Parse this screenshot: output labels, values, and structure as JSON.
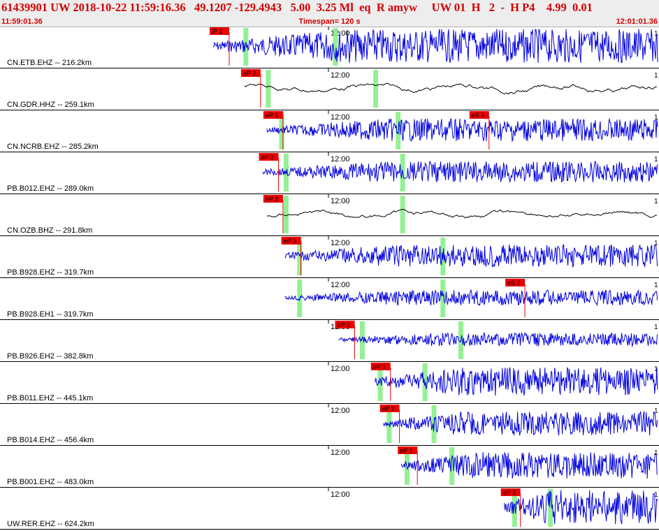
{
  "header": {
    "event_line": "61439901 UW 2018-10-22 11:59:16.36   49.1207 -129.4943   5.00  3.25 Ml  eq  R amyw     UW 01  H   2  -  H P4    4.99  0.01",
    "start_time": "11:59:01.36",
    "timespan": "Timespan= 120 s",
    "end_time": "12:01:01.36"
  },
  "colors": {
    "header_text": "#d40000",
    "trace_primary": "#0000dd",
    "trace_broadband": "#000000",
    "pick_flag": "#ee0000",
    "window_marker": "#88ee88"
  },
  "minute_label": "12:00",
  "end_glyph": "1",
  "traces": [
    {
      "label": "CN.ETB.EHZ -- 216.2km",
      "picks": [
        {
          "text": "iP 1",
          "t": 0.0
        }
      ],
      "windows": [
        0.08,
        0.28
      ],
      "start": 0.0,
      "style": "blue",
      "amp": 0.9
    },
    {
      "label": "CN.GDR.HHZ -- 259.1km",
      "picks": [
        {
          "text": "eP 2",
          "t": 0.07
        }
      ],
      "windows": [
        0.13,
        0.37
      ],
      "start": 0.07,
      "style": "broadband",
      "amp": 0.5
    },
    {
      "label": "CN.NCRB.EHZ -- 285.2km",
      "picks": [
        {
          "text": "eP 1",
          "t": 0.12
        },
        {
          "text": "eS 2",
          "t": 0.58
        }
      ],
      "windows": [
        0.16,
        0.42
      ],
      "start": 0.12,
      "style": "blue",
      "amp": 0.6
    },
    {
      "label": "PB.B012.EHZ -- 289.0km",
      "picks": [
        {
          "text": "eP 2",
          "t": 0.11
        }
      ],
      "windows": [
        0.17,
        0.43
      ],
      "start": 0.11,
      "style": "blue",
      "amp": 0.55
    },
    {
      "label": "CN.OZB.BHZ -- 291.8km",
      "picks": [
        {
          "text": "eP 2",
          "t": 0.12
        }
      ],
      "windows": [
        0.17,
        0.43
      ],
      "start": 0.12,
      "style": "broadband",
      "amp": 0.45
    },
    {
      "label": "PB.B928.EHZ -- 319.7km",
      "picks": [
        {
          "text": "eP 3",
          "t": 0.16
        }
      ],
      "windows": [
        0.2,
        0.52
      ],
      "start": 0.16,
      "style": "blue",
      "amp": 0.6
    },
    {
      "label": "PB.B928.EH1 -- 319.7km",
      "picks": [
        {
          "text": "eS 2",
          "t": 0.66
        }
      ],
      "windows": [
        0.2,
        0.52
      ],
      "start": 0.16,
      "style": "blue",
      "amp": 0.4
    },
    {
      "label": "PB.B926.EH2 -- 382.8km",
      "picks": [
        {
          "text": "eP 2",
          "t": 0.28
        }
      ],
      "windows": [
        0.34,
        0.56
      ],
      "start": 0.28,
      "style": "blue",
      "amp": 0.35
    },
    {
      "label": "PB.B011.EHZ -- 445.1km",
      "picks": [
        {
          "text": "eP 1",
          "t": 0.36
        }
      ],
      "windows": [
        0.38,
        0.48
      ],
      "start": 0.36,
      "style": "blue",
      "amp": 0.75
    },
    {
      "label": "PB.B014.EHZ -- 456.4km",
      "picks": [
        {
          "text": "eP 2",
          "t": 0.38
        }
      ],
      "windows": [
        0.4,
        0.5
      ],
      "start": 0.38,
      "style": "blue",
      "amp": 0.65
    },
    {
      "label": "PB.B001.EHZ -- 483.0km",
      "picks": [
        {
          "text": "eP 1",
          "t": 0.42
        }
      ],
      "windows": [
        0.44,
        0.54
      ],
      "start": 0.42,
      "style": "blue",
      "amp": 0.7
    },
    {
      "label": "UW.RER.EHZ -- 624.2km",
      "picks": [
        {
          "text": "eP 2",
          "t": 0.65
        }
      ],
      "windows": [
        0.68,
        0.76
      ],
      "start": 0.65,
      "style": "blue",
      "amp": 0.95
    }
  ]
}
